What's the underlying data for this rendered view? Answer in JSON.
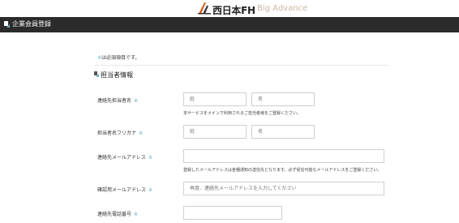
{
  "brand": {
    "name": "西日本FH",
    "sub": "Big Advance"
  },
  "header": {
    "title": "企業会員登録"
  },
  "form": {
    "required_note_mark": "※",
    "required_note_text": "は必須項目です。",
    "section_title": "担当者情報",
    "required_mark": "※",
    "fields": {
      "contact_name": {
        "label": "連絡先担当者名",
        "last_placeholder": "姓",
        "first_placeholder": "名",
        "help": "本サービスをメインで利用されるご担当者様をご登録ください。"
      },
      "contact_kana": {
        "label": "担当者名フリガナ",
        "last_placeholder": "姓",
        "first_placeholder": "名"
      },
      "email": {
        "label": "連絡先メールアドレス",
        "help": "登録したメールアドレスは各種通知の送信先となります。必ず受信可能なメールアドレスをご登録ください。"
      },
      "email_confirm": {
        "label": "確認用メールアドレス",
        "placeholder": "再度、連絡先メールアドレスを入力してください"
      },
      "phone": {
        "label": "連絡先電話番号"
      }
    }
  }
}
